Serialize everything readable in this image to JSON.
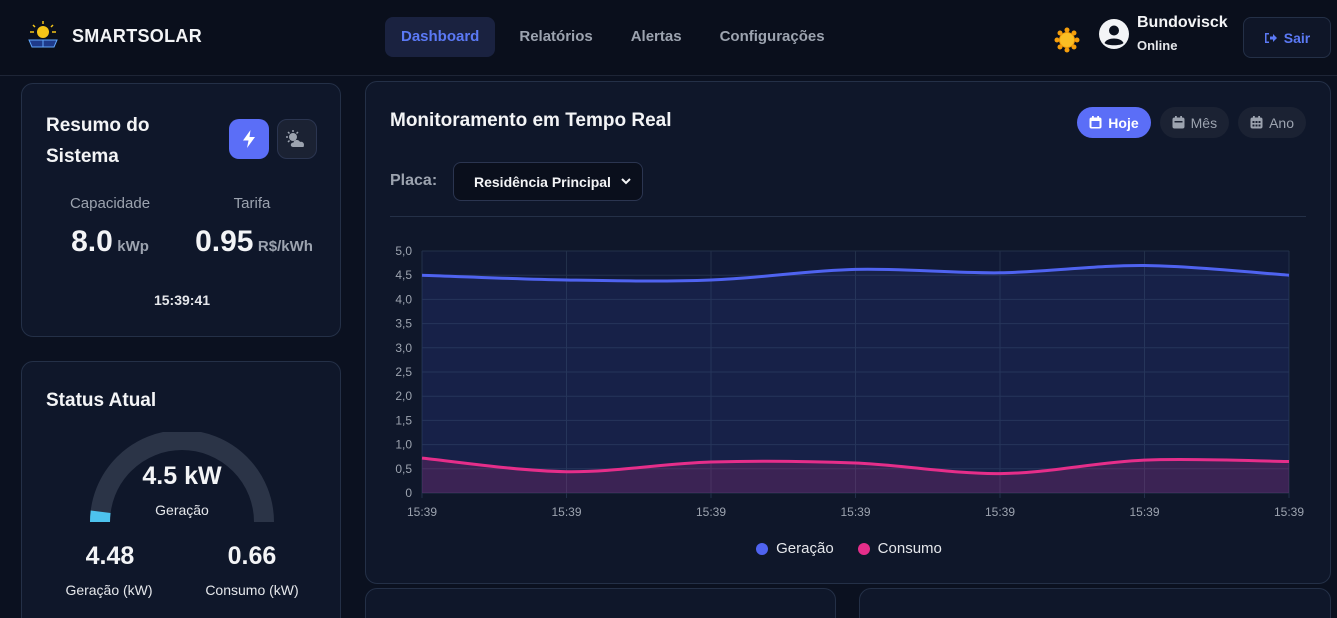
{
  "brand": {
    "name": "SMARTSOLAR"
  },
  "nav": {
    "items": [
      {
        "label": "Dashboard",
        "active": true
      },
      {
        "label": "Relatórios",
        "active": false
      },
      {
        "label": "Alertas",
        "active": false
      },
      {
        "label": "Configurações",
        "active": false
      }
    ]
  },
  "user": {
    "name": "Bundovisck",
    "status": "Online",
    "logout_label": "Sair"
  },
  "summary": {
    "title": "Resumo do Sistema",
    "capacity_label": "Capacidade",
    "capacity_value": "8.0",
    "capacity_unit": "kWp",
    "tariff_label": "Tarifa",
    "tariff_value": "0.95",
    "tariff_unit": "R$/kWh",
    "time": "15:39:41"
  },
  "status": {
    "title": "Status Atual",
    "gauge_value": "4.5 kW",
    "gauge_label": "Geração",
    "gauge_fraction": 0.04,
    "generation_value": "4.48",
    "generation_label": "Geração (kW)",
    "consumption_value": "0.66",
    "consumption_label": "Consumo (kW)"
  },
  "monitor": {
    "title": "Monitoramento em Tempo Real",
    "ranges": [
      {
        "label": "Hoje",
        "active": true
      },
      {
        "label": "Mês",
        "active": false
      },
      {
        "label": "Ano",
        "active": false
      }
    ],
    "placa_label": "Placa:",
    "placa_value": "Residência Principal"
  },
  "colors": {
    "accent": "#5b6ef7",
    "generation": "#4f63f0",
    "consumption": "#e52e8a",
    "gauge_fill": "#4dc3ee"
  },
  "chart_data": {
    "type": "line",
    "x": [
      "15:39",
      "15:39",
      "15:39",
      "15:39",
      "15:39",
      "15:39",
      "15:39"
    ],
    "series": [
      {
        "name": "Geração",
        "values": [
          4.5,
          4.4,
          4.4,
          4.62,
          4.55,
          4.7,
          4.5
        ]
      },
      {
        "name": "Consumo",
        "values": [
          0.72,
          0.44,
          0.64,
          0.62,
          0.4,
          0.68,
          0.65
        ]
      }
    ],
    "yticks": [
      "5,0",
      "4,5",
      "4,0",
      "3,5",
      "3,0",
      "2,5",
      "2,0",
      "1,5",
      "1,0",
      "0,5",
      "0"
    ],
    "ylim": [
      0,
      5
    ],
    "grid": true,
    "legend": "bottom"
  }
}
